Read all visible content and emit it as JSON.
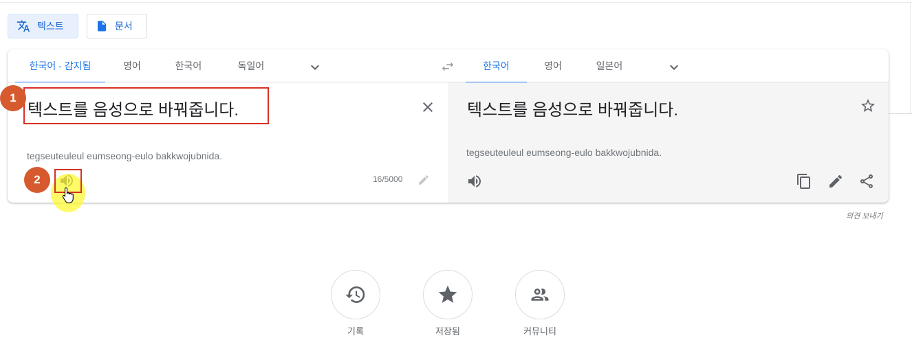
{
  "modes": {
    "text_label": "텍스트",
    "document_label": "문서"
  },
  "source_langs": [
    "한국어 - 감지됨",
    "영어",
    "한국어",
    "독일어"
  ],
  "target_langs": [
    "한국어",
    "영어",
    "일본어"
  ],
  "source": {
    "text": "텍스트를 음성으로 바꿔줍니다.",
    "romanization": "tegseuteuleul eumseong-eulo bakkwojubnida.",
    "char_count": "16/5000"
  },
  "target": {
    "text": "텍스트를 음성으로 바꿔줍니다.",
    "romanization": "tegseuteuleul eumseong-eulo bakkwojubnida."
  },
  "annotations": {
    "step1": "1",
    "step2": "2",
    "highlight_color": "#d93025",
    "badge_color": "#d65a2e"
  },
  "feedback_label": "의견 보내기",
  "bottom": {
    "history_label": "기록",
    "saved_label": "저장됨",
    "community_label": "커뮤니티"
  },
  "icons": [
    "translate-icon",
    "document-icon",
    "chevron-down-icon",
    "swap-icon",
    "close-icon",
    "speaker-icon",
    "pencil-icon",
    "star-icon",
    "copy-icon",
    "edit-icon",
    "share-icon",
    "history-icon",
    "saved-star-icon",
    "community-icon",
    "hand-cursor-icon"
  ],
  "colors": {
    "accent": "#1a73e8",
    "active_tab_bg": "#e8f0fe",
    "target_pane_bg": "#f5f5f5"
  }
}
